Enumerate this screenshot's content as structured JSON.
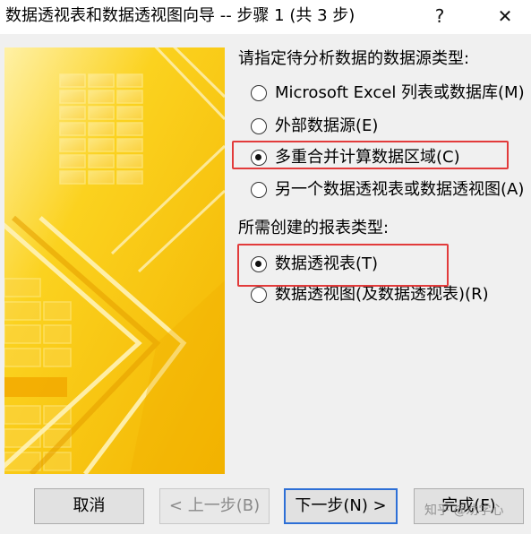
{
  "window": {
    "title": "数据透视表和数据透视图向导 -- 步骤 1 (共 3 步)",
    "help_glyph": "?",
    "close_glyph": "✕"
  },
  "source_section": {
    "label": "请指定待分析数据的数据源类型:",
    "options": [
      {
        "label": "Microsoft Excel 列表或数据库(M)",
        "selected": false
      },
      {
        "label": "外部数据源(E)",
        "selected": false
      },
      {
        "label": "多重合并计算数据区域(C)",
        "selected": true
      },
      {
        "label": "另一个数据透视表或数据透视图(A)",
        "selected": false
      }
    ]
  },
  "report_section": {
    "label": "所需创建的报表类型:",
    "options": [
      {
        "label": "数据透视表(T)",
        "selected": true
      },
      {
        "label": "数据透视图(及数据透视表)(R)",
        "selected": false
      }
    ]
  },
  "buttons": {
    "cancel": "取消",
    "back": "< 上一步(B)",
    "next": "下一步(N) >",
    "finish": "完成(F)"
  },
  "watermark": "知乎 @劝学心",
  "colors": {
    "highlight": "#e23b3b",
    "image_yellow": "#f5c000",
    "default_button_border": "#2d6fd6"
  },
  "icons": {
    "help": "question-mark",
    "close": "x-mark"
  }
}
